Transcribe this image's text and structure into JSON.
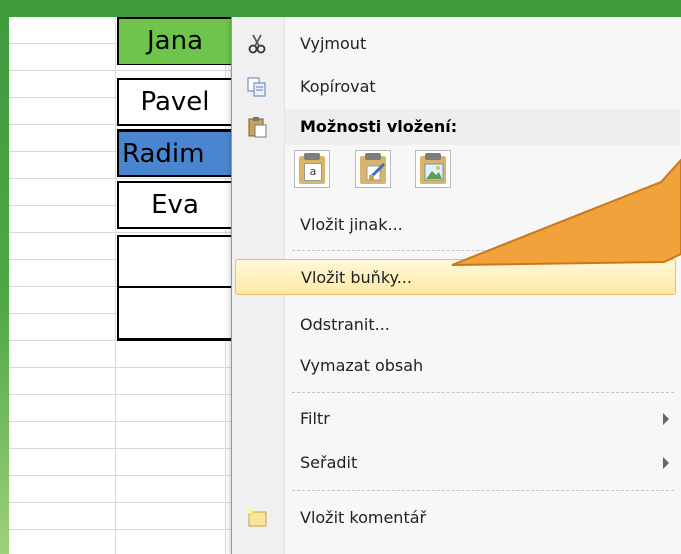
{
  "cells": [
    "Jana",
    "Pavel",
    "Radim",
    "Eva",
    "",
    ""
  ],
  "menu": {
    "cut": "Vyjmout",
    "copy": "Kopírovat",
    "paste_options_header": "Možnosti vložení:",
    "paste_special": "Vložit jinak...",
    "insert_cells": "Vložit buňky...",
    "delete": "Odstranit...",
    "clear_contents": "Vymazat obsah",
    "filter": "Filtr",
    "sort": "Seřadit",
    "insert_comment": "Vložit komentář",
    "paste_icon_text": "a"
  },
  "icons": {
    "cut": "scissors-icon",
    "copy": "copy-icon",
    "paste": "paste-icon",
    "comment": "comment-icon"
  },
  "colors": {
    "frame": "#3f9a3c",
    "cell_jana": "#6fc44b",
    "cell_radim": "#4a86d0",
    "callout": "#f2a23a",
    "highlight": "#fde9a6"
  }
}
